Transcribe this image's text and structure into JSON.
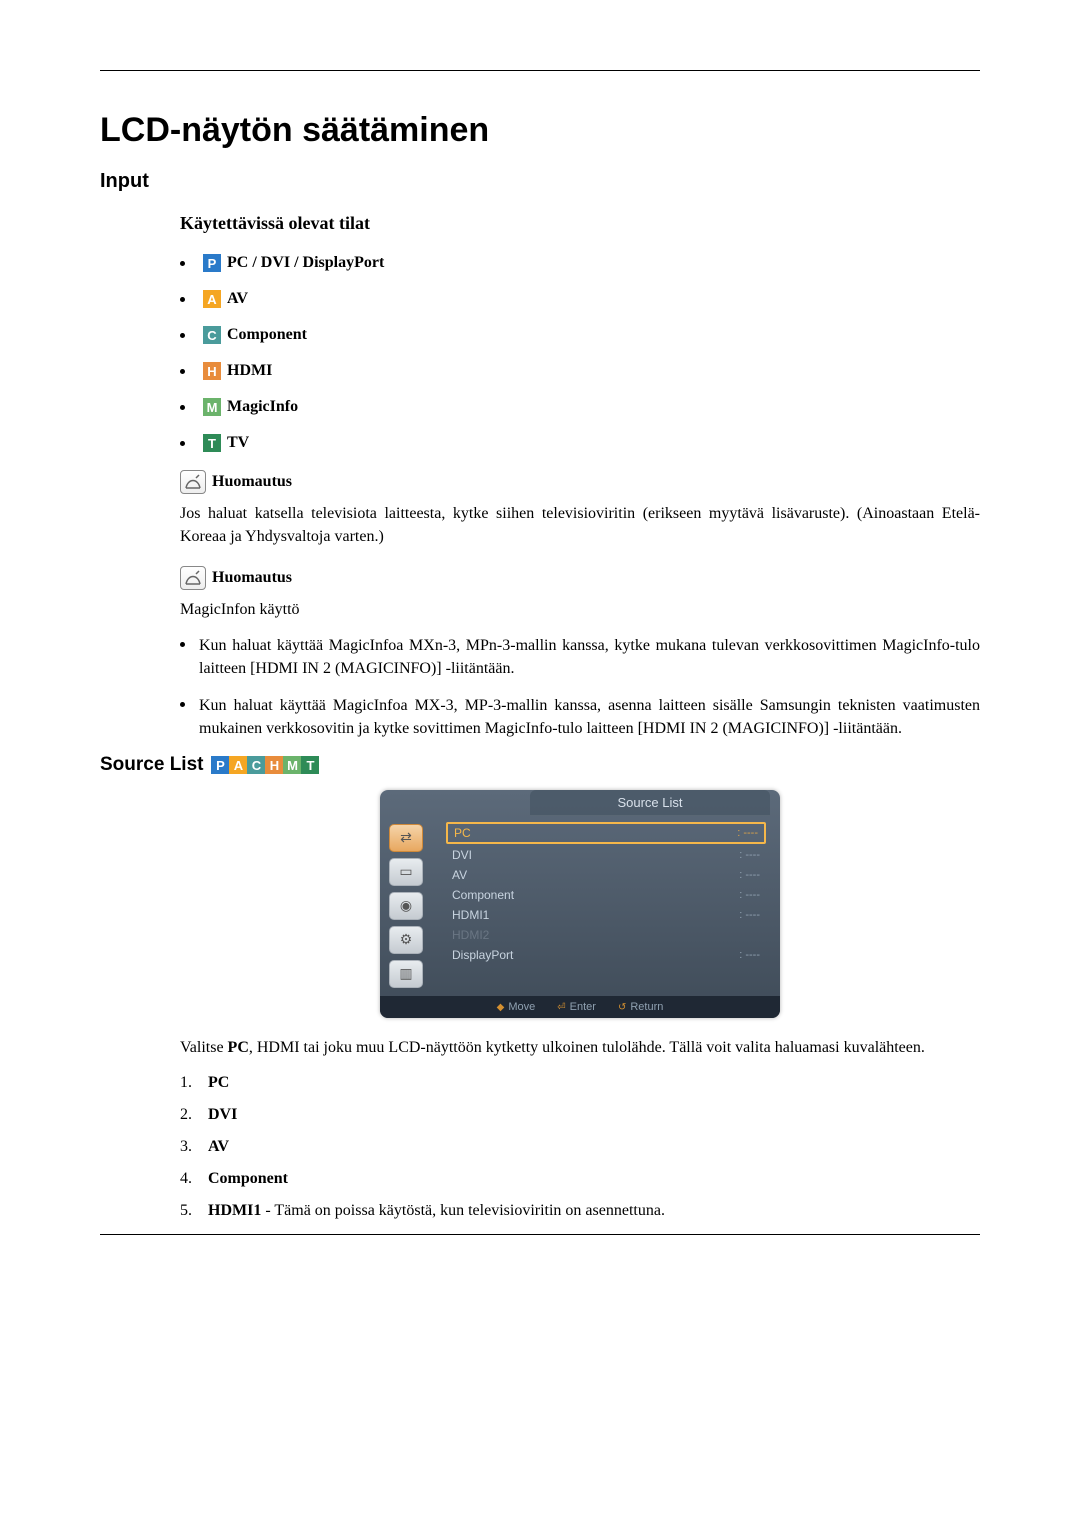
{
  "main_title": "LCD-näytön säätäminen",
  "section_input": "Input",
  "subheading_modes": "Käytettävissä olevat tilat",
  "modes": {
    "p": {
      "letter": "P",
      "label": "PC / DVI / DisplayPort"
    },
    "a": {
      "letter": "A",
      "label": "AV"
    },
    "c": {
      "letter": "C",
      "label": "Component"
    },
    "h": {
      "letter": "H",
      "label": "HDMI"
    },
    "m": {
      "letter": "M",
      "label": "MagicInfo"
    },
    "t": {
      "letter": "T",
      "label": "TV"
    }
  },
  "note_label": "Huomautus",
  "note1_text": "Jos haluat katsella televisiota laitteesta, kytke siihen televisioviritin (erikseen myytävä lisävaruste). (Ainoastaan Etelä-Koreaa ja Yhdysvaltoja varten.)",
  "note2_intro": "MagicInfon käyttö",
  "note2_items": [
    "Kun haluat käyttää MagicInfoa MXn-3, MPn-3-mallin kanssa, kytke mukana tulevan verkkosovittimen MagicInfo-tulo laitteen [HDMI IN 2 (MAGICINFO)] -liitäntään.",
    "Kun haluat käyttää MagicInfoa MX-3, MP-3-mallin kanssa, asenna laitteen sisälle Samsungin teknisten vaatimusten mukainen verkkosovitin ja kytke sovittimen MagicInfo-tulo laitteen [HDMI IN 2 (MAGICINFO)] -liitäntään."
  ],
  "source_list_title": "Source List",
  "osd": {
    "header": "Source List",
    "rows": [
      {
        "name": "PC",
        "val": ": ----",
        "selected": true
      },
      {
        "name": "DVI",
        "val": ": ----"
      },
      {
        "name": "AV",
        "val": ": ----"
      },
      {
        "name": "Component",
        "val": ": ----"
      },
      {
        "name": "HDMI1",
        "val": ": ----"
      },
      {
        "name": "HDMI2",
        "val": "",
        "disabled": true
      },
      {
        "name": "DisplayPort",
        "val": ": ----"
      }
    ],
    "footer": {
      "move": "Move",
      "enter": "Enter",
      "return": "Return"
    }
  },
  "para_after_osd_pre": "Valitse ",
  "para_after_osd_bold": "PC",
  "para_after_osd_post": ", HDMI tai joku muu LCD-näyttöön kytketty ulkoinen tulolähde. Tällä voit valita haluamasi kuvalähteen.",
  "numbered_list": [
    {
      "n": "1.",
      "bold": "PC",
      "rest": ""
    },
    {
      "n": "2.",
      "bold": "DVI",
      "rest": ""
    },
    {
      "n": "3.",
      "bold": "AV",
      "rest": ""
    },
    {
      "n": "4.",
      "bold": "Component",
      "rest": ""
    },
    {
      "n": "5.",
      "bold": "HDMI1",
      "rest": " - Tämä on poissa käytöstä, kun televisioviritin on asennettuna."
    }
  ]
}
